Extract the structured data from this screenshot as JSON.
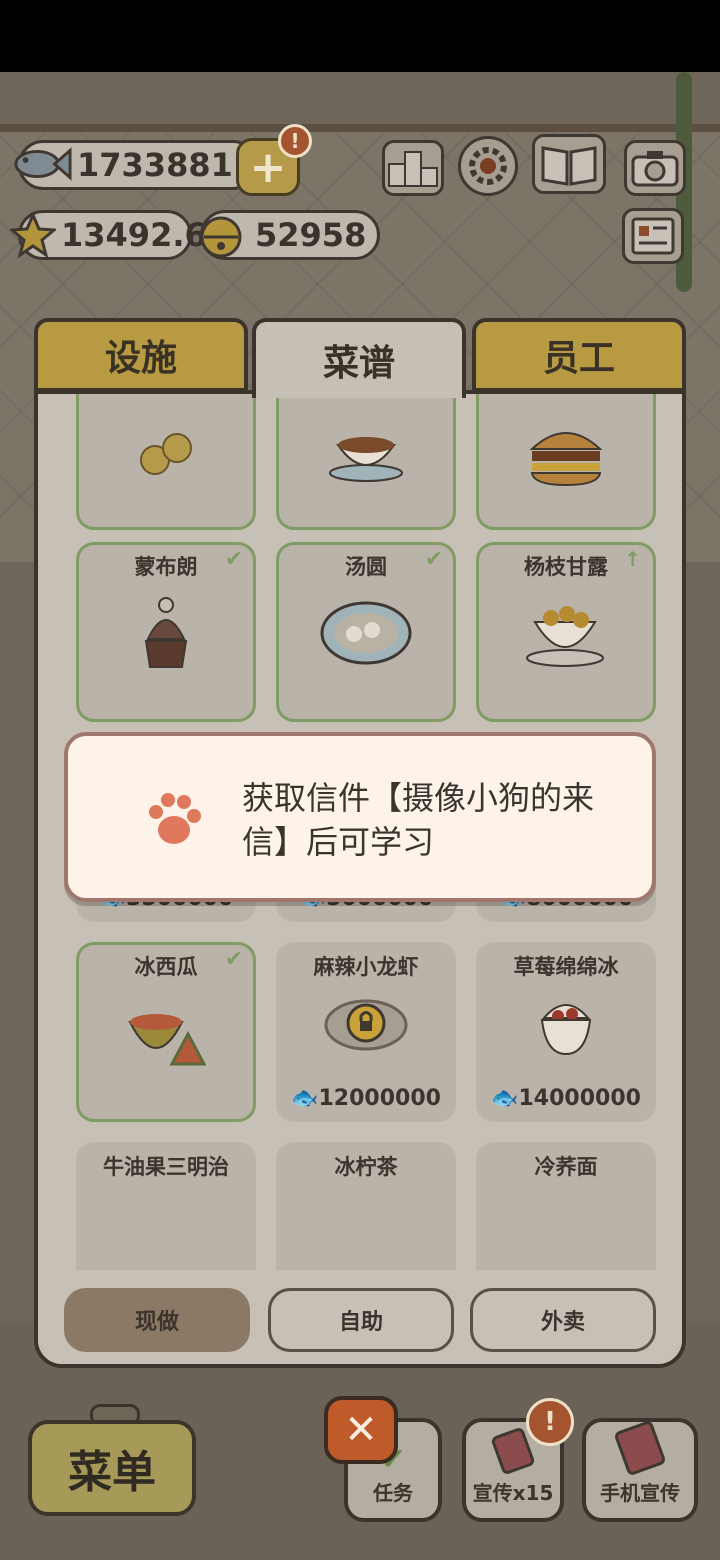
{
  "resources": {
    "fish": "1733881",
    "stars": "13492.6",
    "bells": "52958"
  },
  "top_icons": [
    "ranking-icon",
    "settings-icon",
    "recipe-book-icon",
    "camera-icon",
    "letter-icon"
  ],
  "tabs": [
    {
      "label": "设施",
      "active": false
    },
    {
      "label": "菜谱",
      "active": true
    },
    {
      "label": "员工",
      "active": false
    }
  ],
  "recipes": [
    {
      "name": "",
      "price": "",
      "state": "learned"
    },
    {
      "name": "",
      "price": "",
      "state": "learned"
    },
    {
      "name": "",
      "price": "",
      "state": "learned"
    },
    {
      "name": "蒙布朗",
      "price": "",
      "state": "learned"
    },
    {
      "name": "汤圆",
      "price": "",
      "state": "learned"
    },
    {
      "name": "杨枝甘露",
      "price": "",
      "state": "upgradable"
    },
    {
      "name": "",
      "price": "3500000",
      "state": "locked"
    },
    {
      "name": "",
      "price": "5000000",
      "state": "locked"
    },
    {
      "name": "",
      "price": "8000000",
      "state": "locked"
    },
    {
      "name": "冰西瓜",
      "price": "",
      "state": "learned"
    },
    {
      "name": "麻辣小龙虾",
      "price": "12000000",
      "state": "locked"
    },
    {
      "name": "草莓绵绵冰",
      "price": "14000000",
      "state": "locked"
    },
    {
      "name": "牛油果三明治",
      "price": "",
      "state": "locked"
    },
    {
      "name": "冰柠茶",
      "price": "",
      "state": "locked"
    },
    {
      "name": "冷荞面",
      "price": "",
      "state": "locked"
    }
  ],
  "modes": [
    {
      "label": "现做",
      "active": true
    },
    {
      "label": "自助",
      "active": false
    },
    {
      "label": "外卖",
      "active": false
    }
  ],
  "toast": {
    "message": "获取信件【摄像小狗的来信】后可学习"
  },
  "bottom": {
    "menu_label": "菜单",
    "task_label": "任务",
    "promo_label": "宣传x15",
    "phone_promo_label": "手机宣传"
  },
  "colors": {
    "learned_border": "#7e9c63",
    "alert": "#a4542f",
    "close": "#bf5b2b"
  }
}
